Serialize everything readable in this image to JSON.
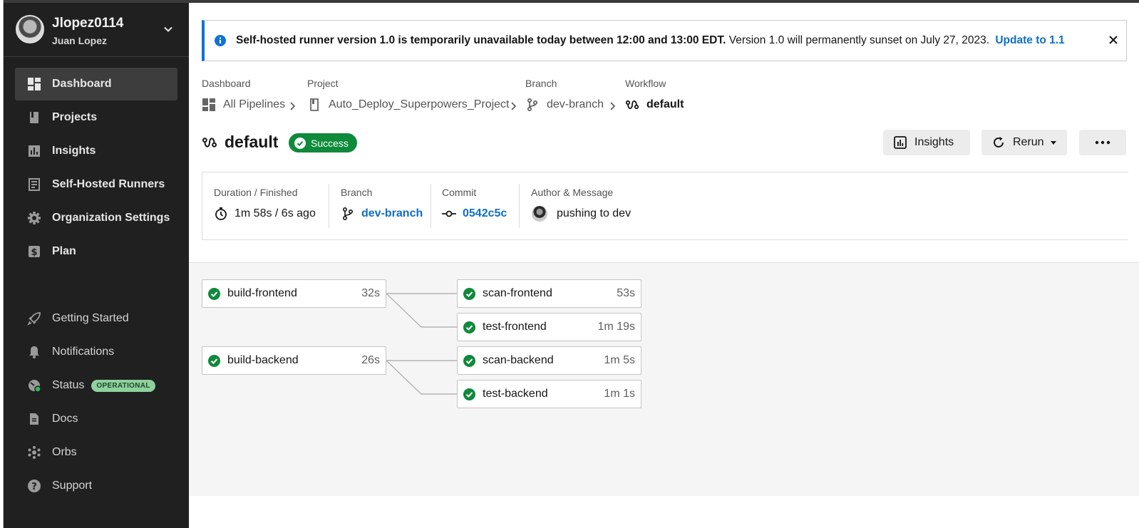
{
  "user": {
    "handle": "Jlopez0114",
    "name": "Juan Lopez"
  },
  "sidebar": {
    "primary": [
      {
        "label": "Dashboard",
        "icon": "dashboard-icon",
        "active": true
      },
      {
        "label": "Projects",
        "icon": "book-icon"
      },
      {
        "label": "Insights",
        "icon": "bar-chart-icon"
      },
      {
        "label": "Self-Hosted Runners",
        "icon": "runner-icon"
      },
      {
        "label": "Organization Settings",
        "icon": "gear-icon"
      },
      {
        "label": "Plan",
        "icon": "dollar-icon"
      }
    ],
    "secondary": [
      {
        "label": "Getting Started",
        "icon": "rocket-icon"
      },
      {
        "label": "Notifications",
        "icon": "bell-icon"
      },
      {
        "label": "Status",
        "icon": "status-icon",
        "badge": "OPERATIONAL"
      },
      {
        "label": "Docs",
        "icon": "document-icon"
      },
      {
        "label": "Orbs",
        "icon": "orbs-icon"
      },
      {
        "label": "Support",
        "icon": "question-icon"
      }
    ]
  },
  "banner": {
    "bold": "Self-hosted runner version 1.0 is temporarily unavailable today between 12:00 and 13:00 EDT.",
    "text": " Version 1.0 will permanently sunset on July 27, 2023.",
    "link": "Update to 1.1"
  },
  "breadcrumbs": [
    {
      "caption": "Dashboard",
      "value": "All Pipelines",
      "icon": "pipelines-icon"
    },
    {
      "caption": "Project",
      "value": "Auto_Deploy_Superpowers_Project",
      "icon": "book-icon"
    },
    {
      "caption": "Branch",
      "value": "dev-branch",
      "icon": "branch-icon"
    },
    {
      "caption": "Workflow",
      "value": "default",
      "icon": "workflow-icon"
    }
  ],
  "workflow": {
    "name": "default",
    "status": "Success"
  },
  "actions": {
    "insights": "Insights",
    "rerun": "Rerun"
  },
  "meta": {
    "duration_caption": "Duration / Finished",
    "duration": "1m 58s / 6s ago",
    "branch_caption": "Branch",
    "branch": "dev-branch",
    "commit_caption": "Commit",
    "commit": "0542c5c",
    "author_caption": "Author & Message",
    "message": "pushing to dev"
  },
  "jobs": [
    {
      "name": "build-frontend",
      "duration": "32s"
    },
    {
      "name": "build-backend",
      "duration": "26s"
    },
    {
      "name": "scan-frontend",
      "duration": "53s"
    },
    {
      "name": "test-frontend",
      "duration": "1m 19s"
    },
    {
      "name": "scan-backend",
      "duration": "1m 5s"
    },
    {
      "name": "test-backend",
      "duration": "1m 1s"
    }
  ],
  "colors": {
    "success": "#0d8a3a",
    "link": "#0f6ec7",
    "sidebar": "#202020",
    "banner_accent": "#0f72d4"
  }
}
